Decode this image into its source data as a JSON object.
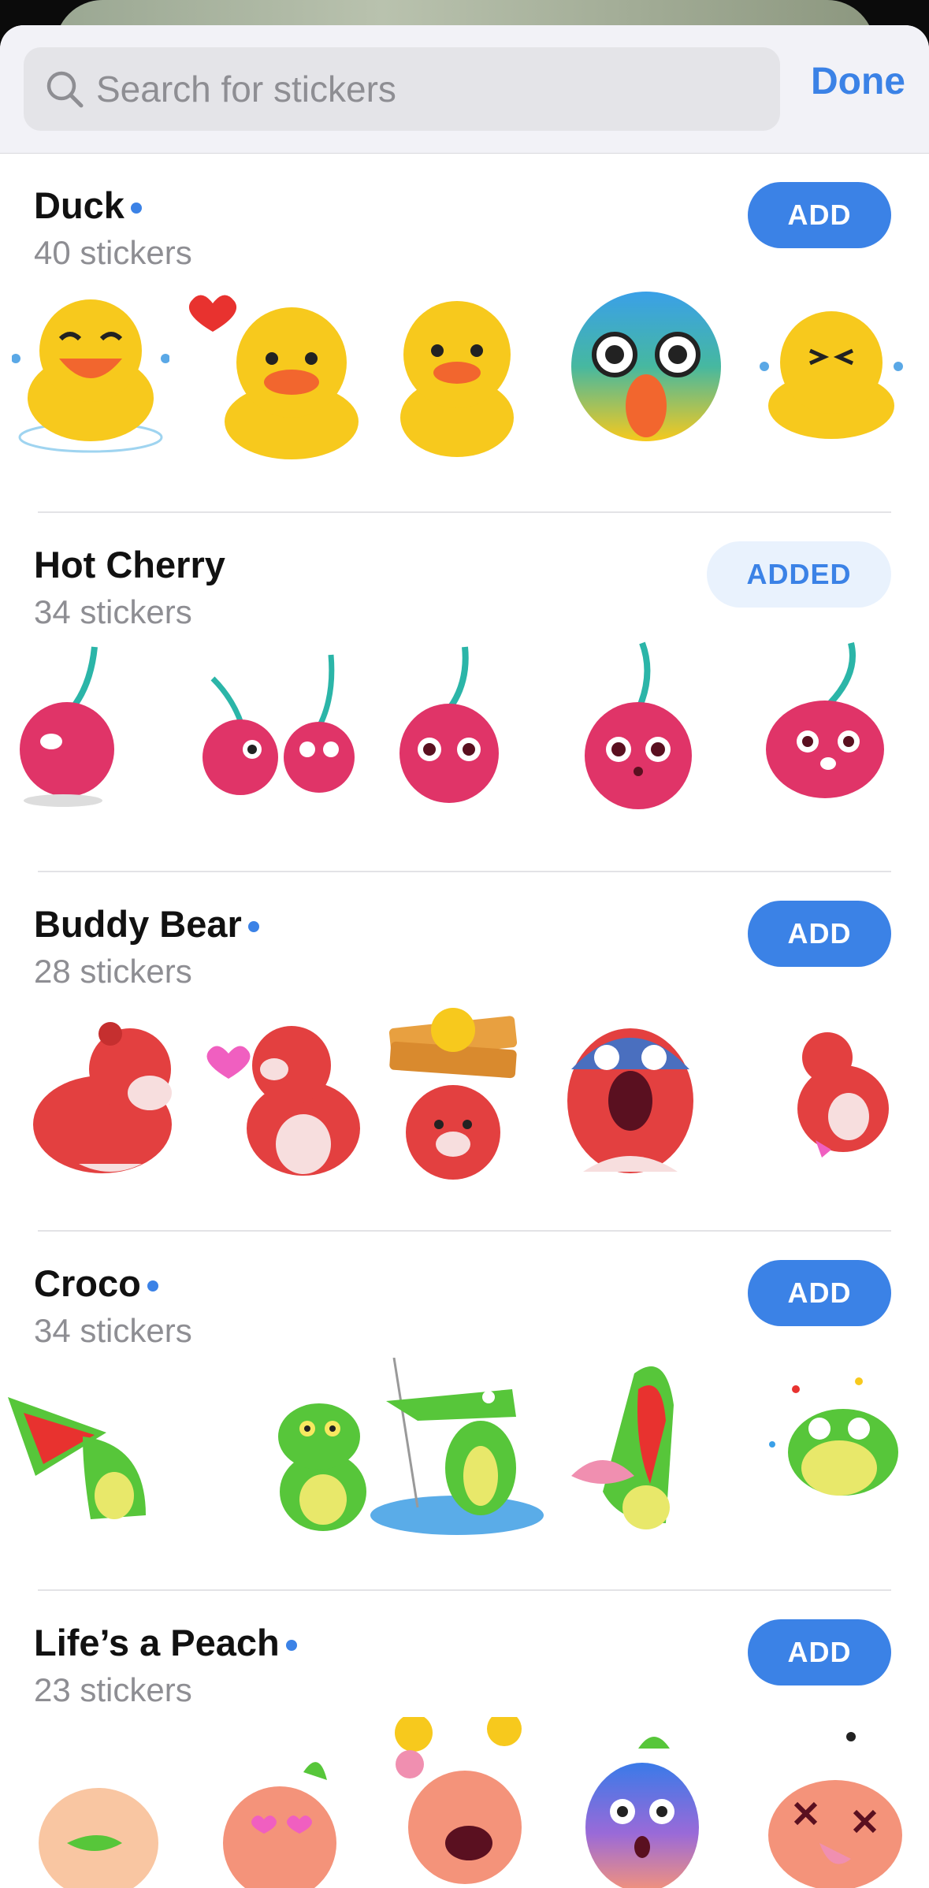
{
  "search": {
    "placeholder": "Search for stickers",
    "value": ""
  },
  "header": {
    "done_label": "Done"
  },
  "packs": [
    {
      "title": "Duck",
      "count": "40 stickers",
      "button": "ADD",
      "unread_dot": true,
      "color": "#f7c91d"
    },
    {
      "title": "Hot Cherry",
      "count": "34 stickers",
      "button": "ADDED",
      "unread_dot": false,
      "color": "#e03468"
    },
    {
      "title": "Buddy Bear",
      "count": "28 stickers",
      "button": "ADD",
      "unread_dot": true,
      "color": "#e34040"
    },
    {
      "title": "Croco",
      "count": "34 stickers",
      "button": "ADD",
      "unread_dot": true,
      "color": "#57c63a"
    },
    {
      "title": "Life’s a Peach",
      "count": "23 stickers",
      "button": "ADD",
      "unread_dot": true,
      "color": "#f4937a"
    }
  ],
  "colors": {
    "accent": "#3b82e6",
    "added_bg": "#e9f2fd"
  }
}
